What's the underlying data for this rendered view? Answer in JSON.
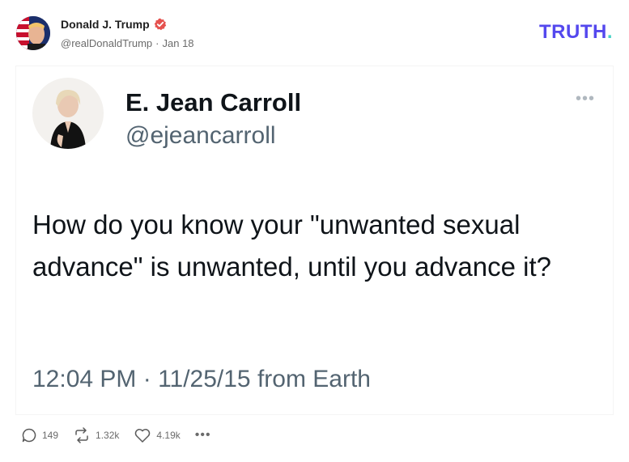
{
  "post": {
    "author_name": "Donald J. Trump",
    "author_handle": "@realDonaldTrump",
    "separator": "·",
    "date": "Jan 18",
    "brand_text": "TRUTH",
    "brand_dot": ".",
    "brand_color": "#5448ee",
    "brand_dot_color": "#4bd3c6",
    "verified_color": "#e6524f"
  },
  "tweet": {
    "name": "E. Jean Carroll",
    "handle": "@ejeancarroll",
    "text": "How do you know your \"unwanted sexual advance\" is unwanted, until you advance it?",
    "timestamp": "12:04 PM · 11/25/15 from Earth",
    "more_icon": "ellipsis-icon"
  },
  "actions": {
    "replies": "149",
    "reposts": "1.32k",
    "likes": "4.19k",
    "reply_icon": "comment-icon",
    "repost_icon": "retruth-icon",
    "like_icon": "heart-icon",
    "more_icon": "ellipsis-icon"
  }
}
